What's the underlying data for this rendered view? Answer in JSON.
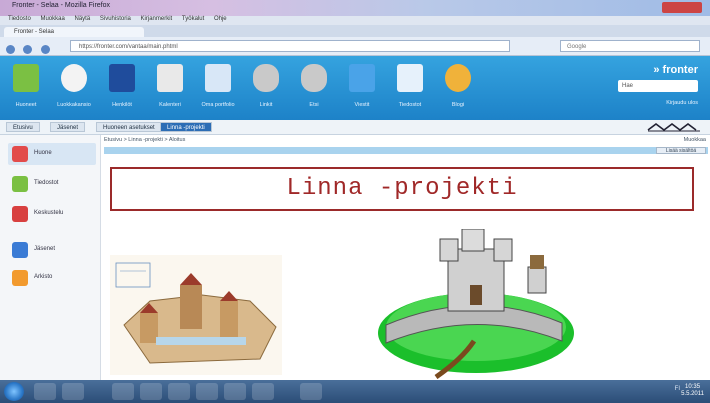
{
  "window": {
    "title": "Fronter - Selaa - Mozilla Firefox"
  },
  "menubar": {
    "items": [
      "Tiedosto",
      "Muokkaa",
      "Näytä",
      "Sivuhistoria",
      "Kirjanmerkit",
      "Työkalut",
      "Ohje"
    ]
  },
  "browser_tab": {
    "label": "Fronter - Selaa"
  },
  "address": {
    "url": "https://fronter.com/vantaa/main.phtml"
  },
  "browser_search": {
    "placeholder": "Google"
  },
  "toolbar": {
    "items": [
      {
        "label": "Huoneet",
        "icon": "door-icon",
        "color": "#7bc043"
      },
      {
        "label": "Luokkakansio",
        "icon": "mail-icon",
        "color": "#f3f3f3"
      },
      {
        "label": "Henkilöt",
        "icon": "save-icon",
        "color": "#1f4c9c"
      },
      {
        "label": "Kalenteri",
        "icon": "calendar-icon",
        "color": "#e9e9e9"
      },
      {
        "label": "Oma portfolio",
        "icon": "notes-icon",
        "color": "#d8e7f7"
      },
      {
        "label": "Linkit",
        "icon": "link-icon",
        "color": "#c9c9c9"
      },
      {
        "label": "Etsi",
        "icon": "link2-icon",
        "color": "#c9c9c9"
      },
      {
        "label": "Viestit",
        "icon": "chat-icon",
        "color": "#4aa3e8"
      },
      {
        "label": "Tiedostot",
        "icon": "docs-icon",
        "color": "#e6f1fb"
      },
      {
        "label": "Blogi",
        "icon": "puzzle-icon",
        "color": "#f0b23a"
      }
    ],
    "brand": "fronter",
    "search_placeholder": "Hae",
    "user_label": "Kirjaudu ulos"
  },
  "subnav": {
    "tabs": [
      {
        "label": "Etusivu",
        "active": false
      },
      {
        "label": "Jäsenet",
        "active": false
      },
      {
        "label": "Huoneen asetukset",
        "active": false
      },
      {
        "label": "Linna -projekti",
        "active": true
      }
    ]
  },
  "sidebar": {
    "items": [
      {
        "label": "Huone",
        "icon": "home-icon",
        "color": "#e24b4b",
        "active": true
      },
      {
        "label": "Tiedostot",
        "icon": "folder-doc-icon",
        "color": "#7bc043",
        "active": false
      },
      {
        "label": "Keskustelu",
        "icon": "people-icon",
        "color": "#d84040",
        "active": false
      },
      {
        "label": "Jäsenet",
        "icon": "person-icon",
        "color": "#3a7bd5",
        "active": false
      },
      {
        "label": "Arkisto",
        "icon": "folder-icon",
        "color": "#f29a2e",
        "active": false
      }
    ]
  },
  "content": {
    "breadcrumb": "Etusivu > Linna -projekti > Aloitus",
    "right_controls": "Muokkaa",
    "right_button": "Lisää sisältöä",
    "banner_title": "Linna -projekti"
  },
  "taskbar": {
    "tray_text": "FI",
    "clock_time": "10:35",
    "clock_date": "5.5.2011"
  }
}
